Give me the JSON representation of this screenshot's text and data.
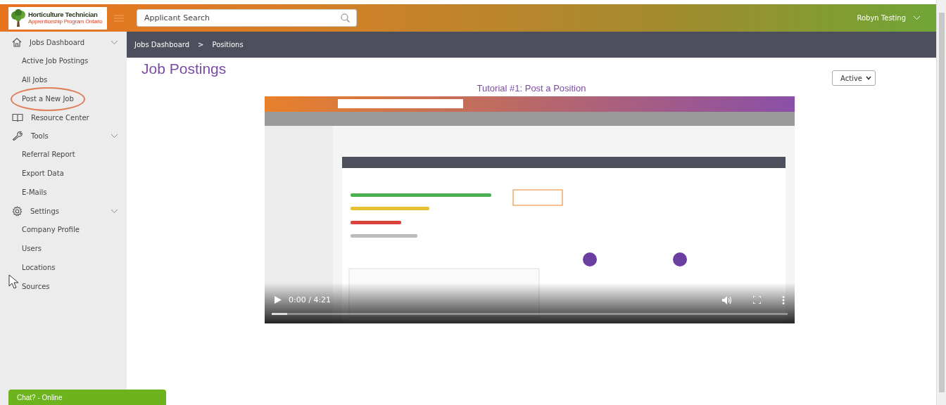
{
  "header": {
    "logo": {
      "title": "Horticulture Technician",
      "subtitle": "Apprenticeship Program Ontario"
    },
    "search": {
      "placeholder": "Applicant Search"
    },
    "user": "Robyn Testing"
  },
  "sidebar": {
    "items": [
      {
        "label": "Jobs Dashboard",
        "children": [
          {
            "label": "Active Job Postings"
          },
          {
            "label": "All Jobs"
          },
          {
            "label": "Post a New Job",
            "circled": true
          }
        ]
      },
      {
        "label": "Resource Center"
      },
      {
        "label": "Tools",
        "children": [
          {
            "label": "Referral Report"
          },
          {
            "label": "Export Data"
          },
          {
            "label": "E-Mails"
          }
        ]
      },
      {
        "label": "Settings",
        "children": [
          {
            "label": "Company Profile"
          },
          {
            "label": "Users"
          },
          {
            "label": "Locations"
          },
          {
            "label": "Sources"
          }
        ]
      }
    ]
  },
  "breadcrumb": [
    "Jobs Dashboard",
    ">",
    "Positions"
  ],
  "page": {
    "title": "Job Postings",
    "filter": "Active",
    "video": {
      "title": "Tutorial #1: Post a Position",
      "time": "0:00 / 4:21",
      "progress": {
        "level": 0.03
      }
    }
  },
  "chat": {
    "label": "Chat? - Online"
  }
}
